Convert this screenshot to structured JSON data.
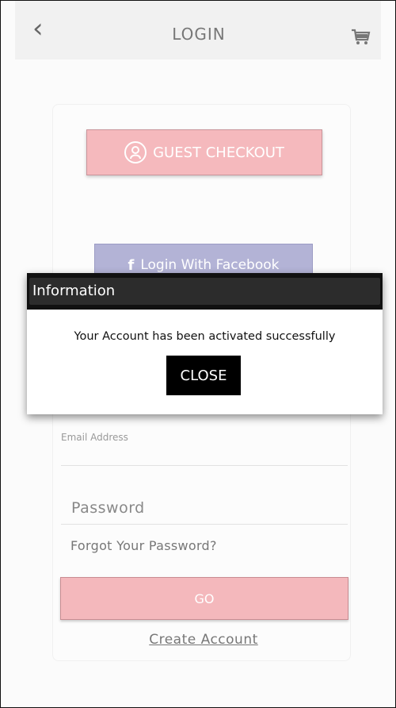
{
  "header": {
    "title": "LOGIN",
    "back_icon": "chevron-left-icon",
    "cart_icon": "cart-icon"
  },
  "login": {
    "guest_checkout_label": "GUEST CHECKOUT",
    "facebook_label": "Login With Facebook",
    "email_placeholder": "Email Address",
    "password_placeholder": "Password",
    "forgot_password_label": "Forgot Your Password?",
    "go_label": "GO",
    "create_account_label": "Create Account"
  },
  "dialog": {
    "title": "Information",
    "message": "Your Account has been activated successfully",
    "close_label": "CLOSE"
  },
  "colors": {
    "accent_pink": "#f5b9bd",
    "facebook_purple": "#b3b3d6",
    "dialog_header": "#111111"
  }
}
